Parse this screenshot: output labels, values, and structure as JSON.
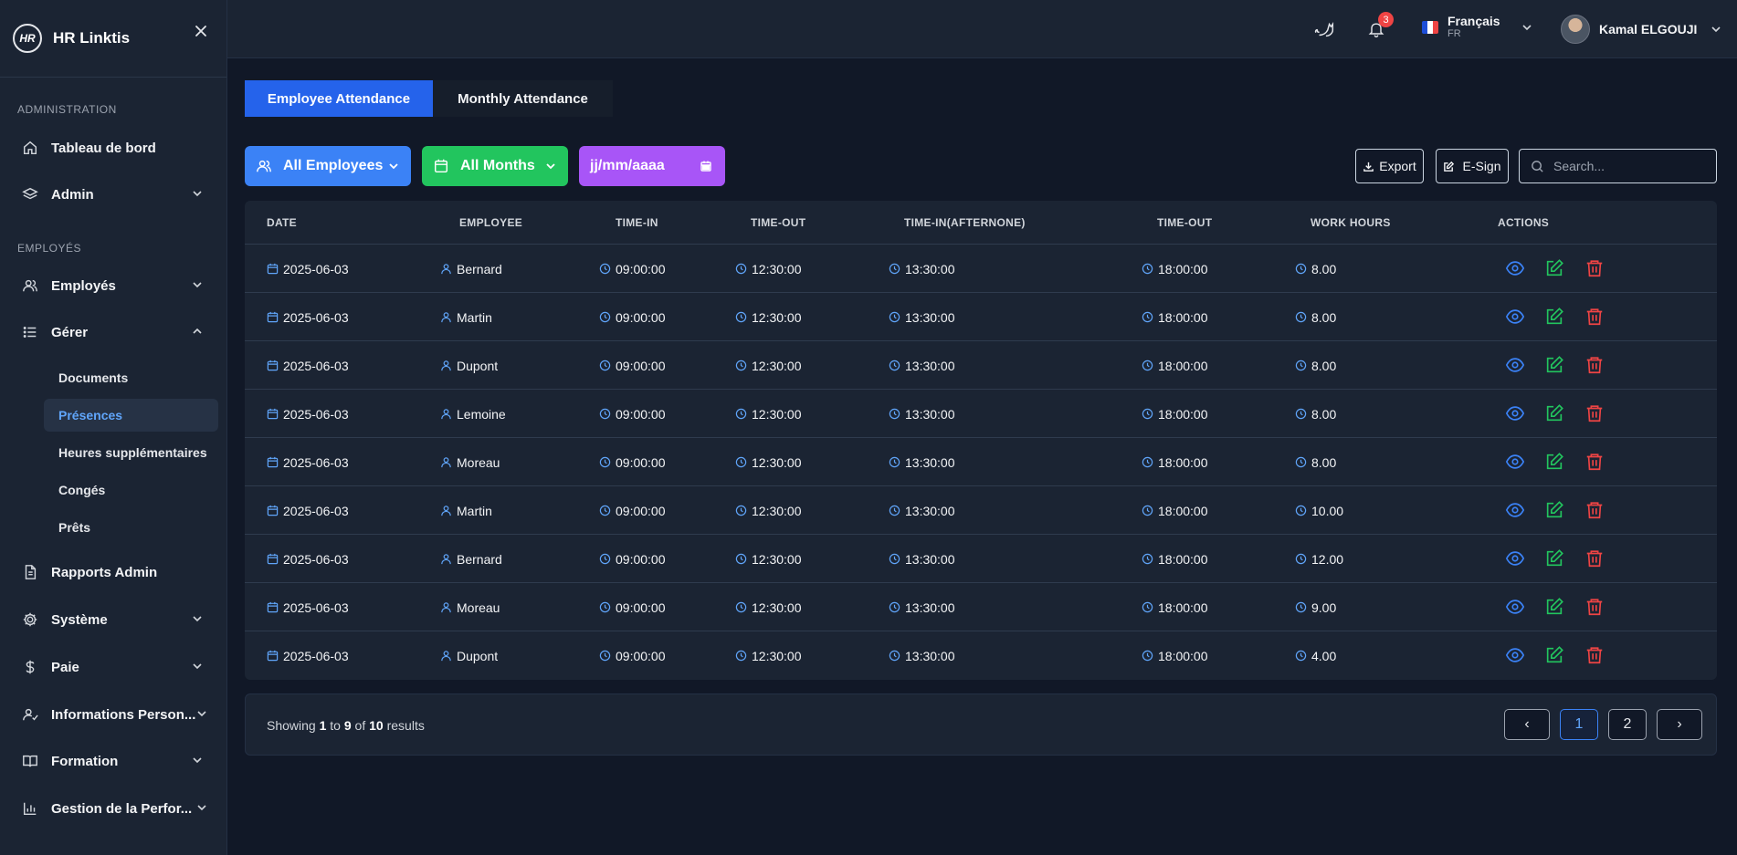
{
  "brand": {
    "logo_text": "HR",
    "name": "HR Linktis"
  },
  "sidebar": {
    "sections": [
      "ADMINISTRATION",
      "EMPLOYÉS"
    ],
    "items": [
      {
        "label": "Tableau de bord",
        "icon": "home-icon"
      },
      {
        "label": "Admin",
        "icon": "layers-icon"
      },
      {
        "label": "Employés",
        "icon": "users-icon"
      },
      {
        "label": "Gérer",
        "icon": "list-icon"
      },
      {
        "label": "Rapports Admin",
        "icon": "file-icon"
      },
      {
        "label": "Système",
        "icon": "gear-icon"
      },
      {
        "label": "Paie",
        "icon": "dollar-icon"
      },
      {
        "label": "Informations Person...",
        "icon": "user-check-icon"
      },
      {
        "label": "Formation",
        "icon": "book-icon"
      },
      {
        "label": "Gestion de la Perfor...",
        "icon": "bar-chart-icon"
      }
    ],
    "sub_items": [
      {
        "label": "Documents"
      },
      {
        "label": "Présences",
        "active": true
      },
      {
        "label": "Heures supplémentaires"
      },
      {
        "label": "Congés"
      },
      {
        "label": "Prêts"
      }
    ]
  },
  "topbar": {
    "notifications_count": "3",
    "language": {
      "name": "Français",
      "code": "FR"
    },
    "user": {
      "name": "Kamal ELGOUJI"
    }
  },
  "tabs": [
    {
      "label": "Employee Attendance",
      "active": true
    },
    {
      "label": "Monthly Attendance",
      "active": false
    }
  ],
  "filters": {
    "employees": "All Employees",
    "months": "All Months",
    "date": "jj/mm/aaaa"
  },
  "toolbar": {
    "export_label": "Export",
    "esign_label": "E-Sign",
    "search_placeholder": "Search..."
  },
  "table": {
    "columns": [
      "DATE",
      "EMPLOYEE",
      "TIME-IN",
      "TIME-OUT",
      "TIME-IN(AFTERNONE)",
      "TIME-OUT",
      "WORK HOURS",
      "ACTIONS"
    ],
    "rows": [
      {
        "date": "2025-06-03",
        "employee": "Bernard",
        "time_in": "09:00:00",
        "time_out": "12:30:00",
        "time_in_pm": "13:30:00",
        "time_out_pm": "18:00:00",
        "hours": "8.00"
      },
      {
        "date": "2025-06-03",
        "employee": "Martin",
        "time_in": "09:00:00",
        "time_out": "12:30:00",
        "time_in_pm": "13:30:00",
        "time_out_pm": "18:00:00",
        "hours": "8.00"
      },
      {
        "date": "2025-06-03",
        "employee": "Dupont",
        "time_in": "09:00:00",
        "time_out": "12:30:00",
        "time_in_pm": "13:30:00",
        "time_out_pm": "18:00:00",
        "hours": "8.00"
      },
      {
        "date": "2025-06-03",
        "employee": "Lemoine",
        "time_in": "09:00:00",
        "time_out": "12:30:00",
        "time_in_pm": "13:30:00",
        "time_out_pm": "18:00:00",
        "hours": "8.00"
      },
      {
        "date": "2025-06-03",
        "employee": "Moreau",
        "time_in": "09:00:00",
        "time_out": "12:30:00",
        "time_in_pm": "13:30:00",
        "time_out_pm": "18:00:00",
        "hours": "8.00"
      },
      {
        "date": "2025-06-03",
        "employee": "Martin",
        "time_in": "09:00:00",
        "time_out": "12:30:00",
        "time_in_pm": "13:30:00",
        "time_out_pm": "18:00:00",
        "hours": "10.00"
      },
      {
        "date": "2025-06-03",
        "employee": "Bernard",
        "time_in": "09:00:00",
        "time_out": "12:30:00",
        "time_in_pm": "13:30:00",
        "time_out_pm": "18:00:00",
        "hours": "12.00"
      },
      {
        "date": "2025-06-03",
        "employee": "Moreau",
        "time_in": "09:00:00",
        "time_out": "12:30:00",
        "time_in_pm": "13:30:00",
        "time_out_pm": "18:00:00",
        "hours": "9.00"
      },
      {
        "date": "2025-06-03",
        "employee": "Dupont",
        "time_in": "09:00:00",
        "time_out": "12:30:00",
        "time_in_pm": "13:30:00",
        "time_out_pm": "18:00:00",
        "hours": "4.00"
      }
    ]
  },
  "pagination": {
    "showing": "Showing",
    "from": "1",
    "to_word": "to",
    "to": "9",
    "of_word": "of",
    "total": "10",
    "results_word": "results",
    "prev": "‹",
    "next": "›",
    "pages": [
      "1",
      "2"
    ],
    "current": "1"
  },
  "colors": {
    "accent_blue": "#2563eb",
    "green": "#22c55e",
    "purple": "#a855f7",
    "danger": "#ef4444",
    "bg": "#111827",
    "panel": "#1b2433"
  }
}
